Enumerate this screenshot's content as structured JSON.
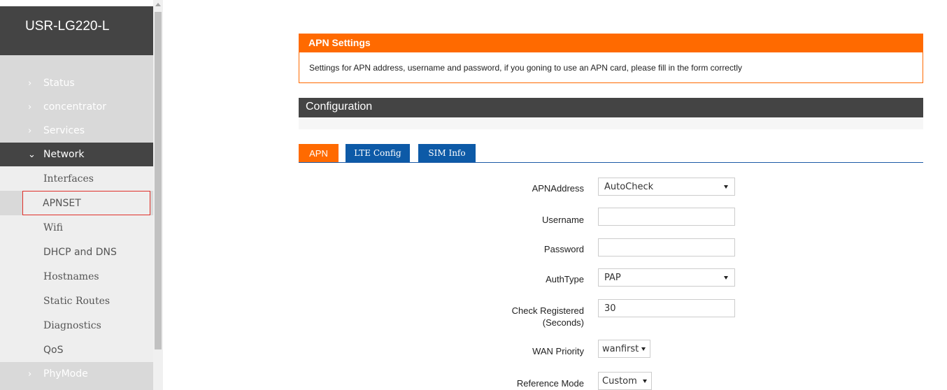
{
  "brand": "USR-LG220-L",
  "sidebar": {
    "top_items": [
      "Status",
      "concentrator",
      "Services"
    ],
    "active_item": "Network",
    "sub_items": [
      "Interfaces",
      "APNSET",
      "Wifi",
      "DHCP and DNS",
      "Hostnames",
      "Static Routes",
      "Diagnostics",
      "QoS"
    ],
    "bottom_item": "PhyMode"
  },
  "apn_panel": {
    "title": "APN Settings",
    "description": "Settings for APN address, username and password, if you goning to use an APN card, please fill in the form correctly"
  },
  "config_title": "Configuration",
  "tabs": [
    "APN",
    "LTE Config",
    "SIM Info"
  ],
  "form": {
    "apn_address_label": "APNAddress",
    "apn_address_value": "AutoCheck",
    "username_label": "Username",
    "username_value": "",
    "password_label": "Password",
    "password_value": "",
    "authtype_label": "AuthType",
    "authtype_value": "PAP",
    "check_registered_label": "Check Registered",
    "check_registered_unit": "(Seconds)",
    "check_registered_value": "30",
    "wan_priority_label": "WAN Priority",
    "wan_priority_value": "wanfirst",
    "reference_mode_label": "Reference Mode",
    "reference_mode_value": "Custom"
  },
  "colors": {
    "accent": "#ff6a00",
    "tab_blue": "#0d5aa7",
    "dark_bar": "#444444",
    "selected_outline": "#e0302a"
  }
}
